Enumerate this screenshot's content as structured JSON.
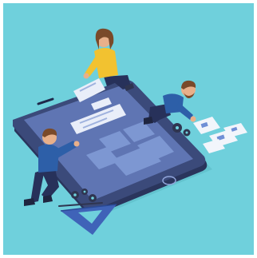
{
  "illustration": {
    "colors": {
      "background": "#6fd0dc",
      "phone_body": "#3b4a7a",
      "phone_edge": "#2a355c",
      "phone_screen": "#5f75b3",
      "screen_tile": "#7d97d2",
      "screen_tile_light": "#e9eef9",
      "sweater_yellow": "#f2c230",
      "shirt_blue": "#2d5fa8",
      "pants_navy": "#27315a",
      "skin": "#e8b08a",
      "hair_brown": "#7a4a2a",
      "paper": "#f2f5fb",
      "paper_accent": "#6f8fd6",
      "ruler_blue": "#3f63b8",
      "gear_dark": "#2f3550"
    },
    "elements": [
      "smartphone",
      "woman-in-yellow-sweater",
      "man-kneeling-left",
      "man-crouching-right",
      "ui-wireframe-cards",
      "scattered-sketch-papers",
      "gears",
      "triangle-ruler"
    ]
  }
}
